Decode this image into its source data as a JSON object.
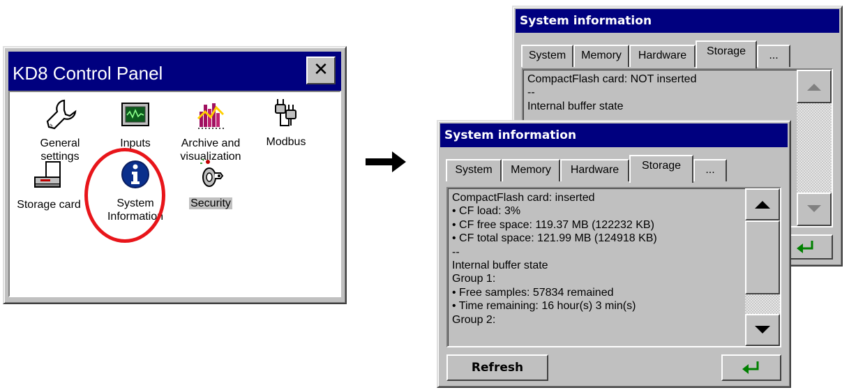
{
  "control_panel": {
    "title": "KD8 Control Panel",
    "close_glyph": "✕",
    "items": [
      {
        "label_lines": [
          "General",
          "settings"
        ],
        "icon": "wrench-icon"
      },
      {
        "label_lines": [
          "Inputs"
        ],
        "icon": "inputs-monitor-icon"
      },
      {
        "label_lines": [
          "Archive and",
          "visualization"
        ],
        "icon": "archive-chart-icon"
      },
      {
        "label_lines": [
          "Modbus"
        ],
        "icon": "modbus-plug-icon"
      },
      {
        "label_lines": [
          "Storage card"
        ],
        "icon": "storage-card-icon"
      },
      {
        "label_lines": [
          "System",
          "Information"
        ],
        "icon": "info-icon"
      },
      {
        "label_lines": [
          "Security"
        ],
        "icon": "security-key-icon"
      }
    ],
    "selected_item": "Security",
    "highlight_color": "#e8151a"
  },
  "arrow": {
    "icon": "right-arrow-icon"
  },
  "system_info_back": {
    "title": "System information",
    "tabs": [
      "System",
      "Memory",
      "Hardware",
      "Storage",
      "..."
    ],
    "active_tab": "Storage",
    "lines": [
      "CompactFlash card: NOT inserted",
      "--",
      "Internal buffer state"
    ],
    "enter_icon": "enter-icon"
  },
  "system_info_front": {
    "title": "System information",
    "tabs": [
      "System",
      "Memory",
      "Hardware",
      "Storage",
      "..."
    ],
    "active_tab": "Storage",
    "lines": [
      "CompactFlash card: inserted",
      "• CF load: 3%",
      "• CF free space: 119.37 MB (122232 KB)",
      "• CF total space: 121.99 MB (124918 KB)",
      "--",
      "Internal buffer state",
      "Group 1:",
      "• Free samples: 57834 remained",
      "• Time remaining: 16 hour(s) 3 min(s)",
      "Group 2:"
    ],
    "refresh_label": "Refresh",
    "enter_icon": "enter-icon"
  },
  "colors": {
    "title_bar": "#00007f",
    "face": "#c0c0c0",
    "enter_arrow": "#008000"
  }
}
